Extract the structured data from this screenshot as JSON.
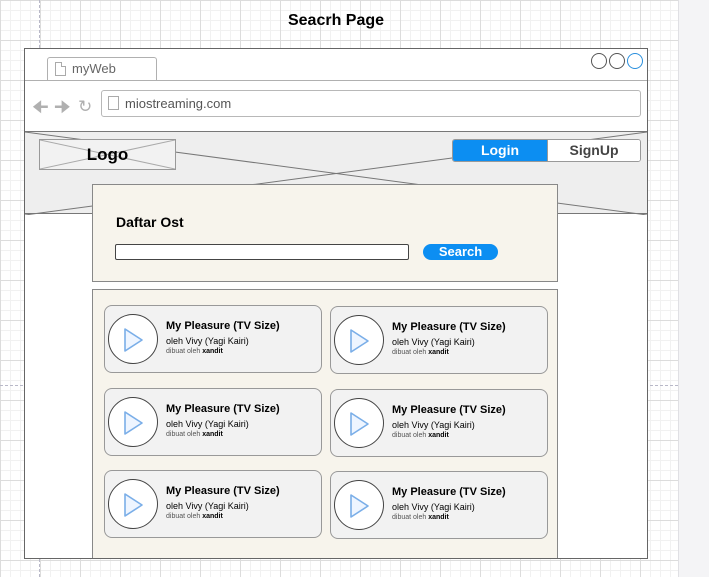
{
  "page_title": "Seacrh Page",
  "browser": {
    "tab_label": "myWeb",
    "address": "miostreaming.com"
  },
  "header": {
    "logo_text": "Logo",
    "login_label": "Login",
    "signup_label": "SignUp"
  },
  "search": {
    "title": "Daftar Ost",
    "input_value": "",
    "button_label": "Search"
  },
  "results": [
    {
      "title": "My Pleasure (TV Size)",
      "artist": "oleh Vivy (Yagi Kairi)",
      "credit_prefix": "dibuat oleh",
      "credit_author": "xandit"
    },
    {
      "title": "My Pleasure (TV Size)",
      "artist": "oleh Vivy (Yagi Kairi)",
      "credit_prefix": "dibuat oleh",
      "credit_author": "xandit"
    },
    {
      "title": "My Pleasure (TV Size)",
      "artist": "oleh Vivy (Yagi Kairi)",
      "credit_prefix": "dibuat oleh",
      "credit_author": "xandit"
    },
    {
      "title": "My Pleasure (TV Size)",
      "artist": "oleh Vivy (Yagi Kairi)",
      "credit_prefix": "dibuat oleh",
      "credit_author": "xandit"
    },
    {
      "title": "My Pleasure (TV Size)",
      "artist": "oleh Vivy (Yagi Kairi)",
      "credit_prefix": "dibuat oleh",
      "credit_author": "xandit"
    },
    {
      "title": "My Pleasure (TV Size)",
      "artist": "oleh Vivy (Yagi Kairi)",
      "credit_prefix": "dibuat oleh",
      "credit_author": "xandit"
    }
  ],
  "colors": {
    "accent": "#0c8ef2",
    "panel_bg": "#f7f4ec",
    "play_icon": "#7aaee8"
  },
  "icons": [
    "document-icon",
    "back-arrow-icon",
    "forward-arrow-icon",
    "refresh-icon",
    "play-icon"
  ]
}
